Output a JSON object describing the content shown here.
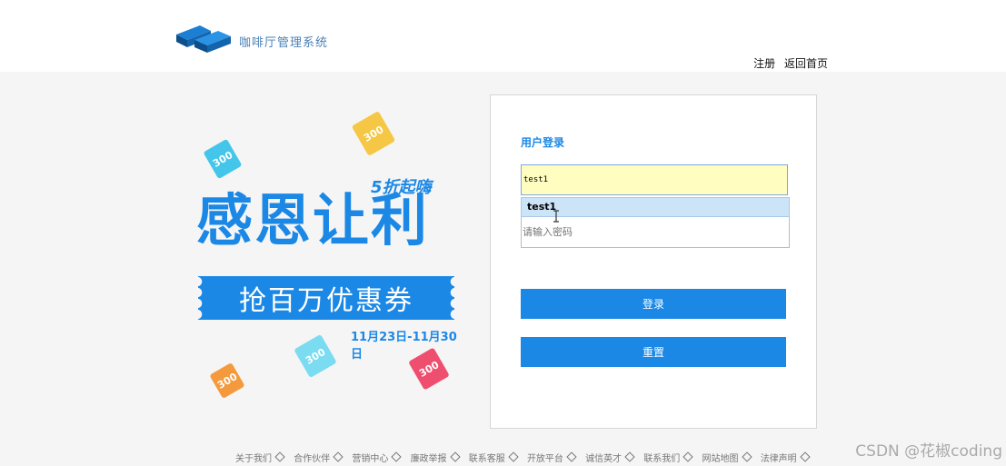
{
  "header": {
    "app_title": "咖啡厅管理系统",
    "links": [
      "注册",
      "返回首页"
    ]
  },
  "promo": {
    "ticket_value": "300",
    "tagline": "5折起嗨",
    "headline": "感恩让利",
    "banner": "抢百万优惠券",
    "dates": "11月23日-11月30日"
  },
  "login": {
    "title": "用户登录",
    "username_value": "test1",
    "autocomplete_suggestion": "test1",
    "password_placeholder": "请输入密码",
    "login_button": "登录",
    "reset_button": "重置"
  },
  "footer": {
    "links": [
      "关于我们",
      "合作伙伴",
      "营销中心",
      "廉政举报",
      "联系客服",
      "开放平台",
      "诚信英才",
      "联系我们",
      "网站地图",
      "法律声明"
    ]
  },
  "watermark": "CSDN @花椒coding",
  "colors": {
    "accent": "#1b88e6",
    "autofill_bg": "#fffec0",
    "page_bg": "#f5f5f5"
  }
}
